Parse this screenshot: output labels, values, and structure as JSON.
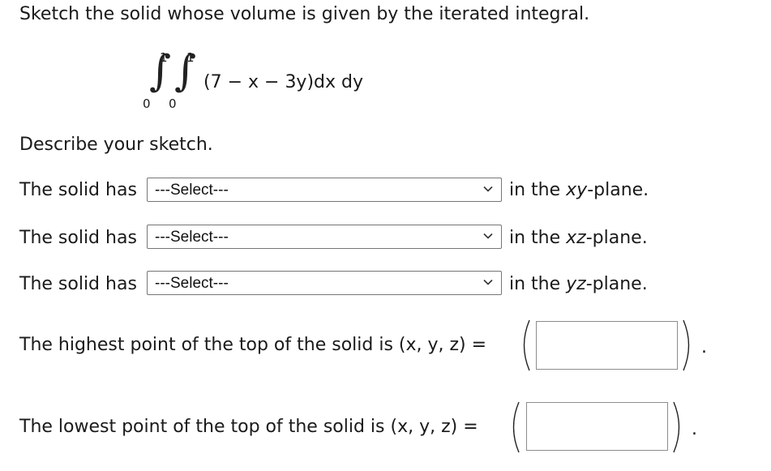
{
  "title": "Sketch the solid whose volume is given by the iterated integral.",
  "integral": {
    "outer_upper": "1",
    "outer_lower": "0",
    "inner_upper": "1",
    "inner_lower": "0",
    "integrand": "(7 − x − 3y)dx dy"
  },
  "describe_prompt": "Describe your sketch.",
  "select_rows": [
    {
      "lead": "The solid has",
      "selected": "---Select---",
      "trail_prefix": "in the ",
      "plane": "xy",
      "trail_suffix": "-plane."
    },
    {
      "lead": "The solid has",
      "selected": "---Select---",
      "trail_prefix": "in the ",
      "plane": "xz",
      "trail_suffix": "-plane."
    },
    {
      "lead": "The solid has",
      "selected": "---Select---",
      "trail_prefix": "in the ",
      "plane": "yz",
      "trail_suffix": "-plane."
    }
  ],
  "highest_point": {
    "label": "The highest point of the top of the solid is (x, y, z)  =",
    "value": "",
    "end": "."
  },
  "lowest_point": {
    "label": "The lowest point of the top of the solid is (x, y, z)  =",
    "value": "",
    "end": "."
  },
  "icons": {
    "chevron": "chevron-down-icon",
    "paren_left": "left-paren-icon",
    "paren_right": "right-paren-icon"
  },
  "colors": {
    "text": "#1a1a1a",
    "border": "#767676",
    "background": "#ffffff"
  }
}
